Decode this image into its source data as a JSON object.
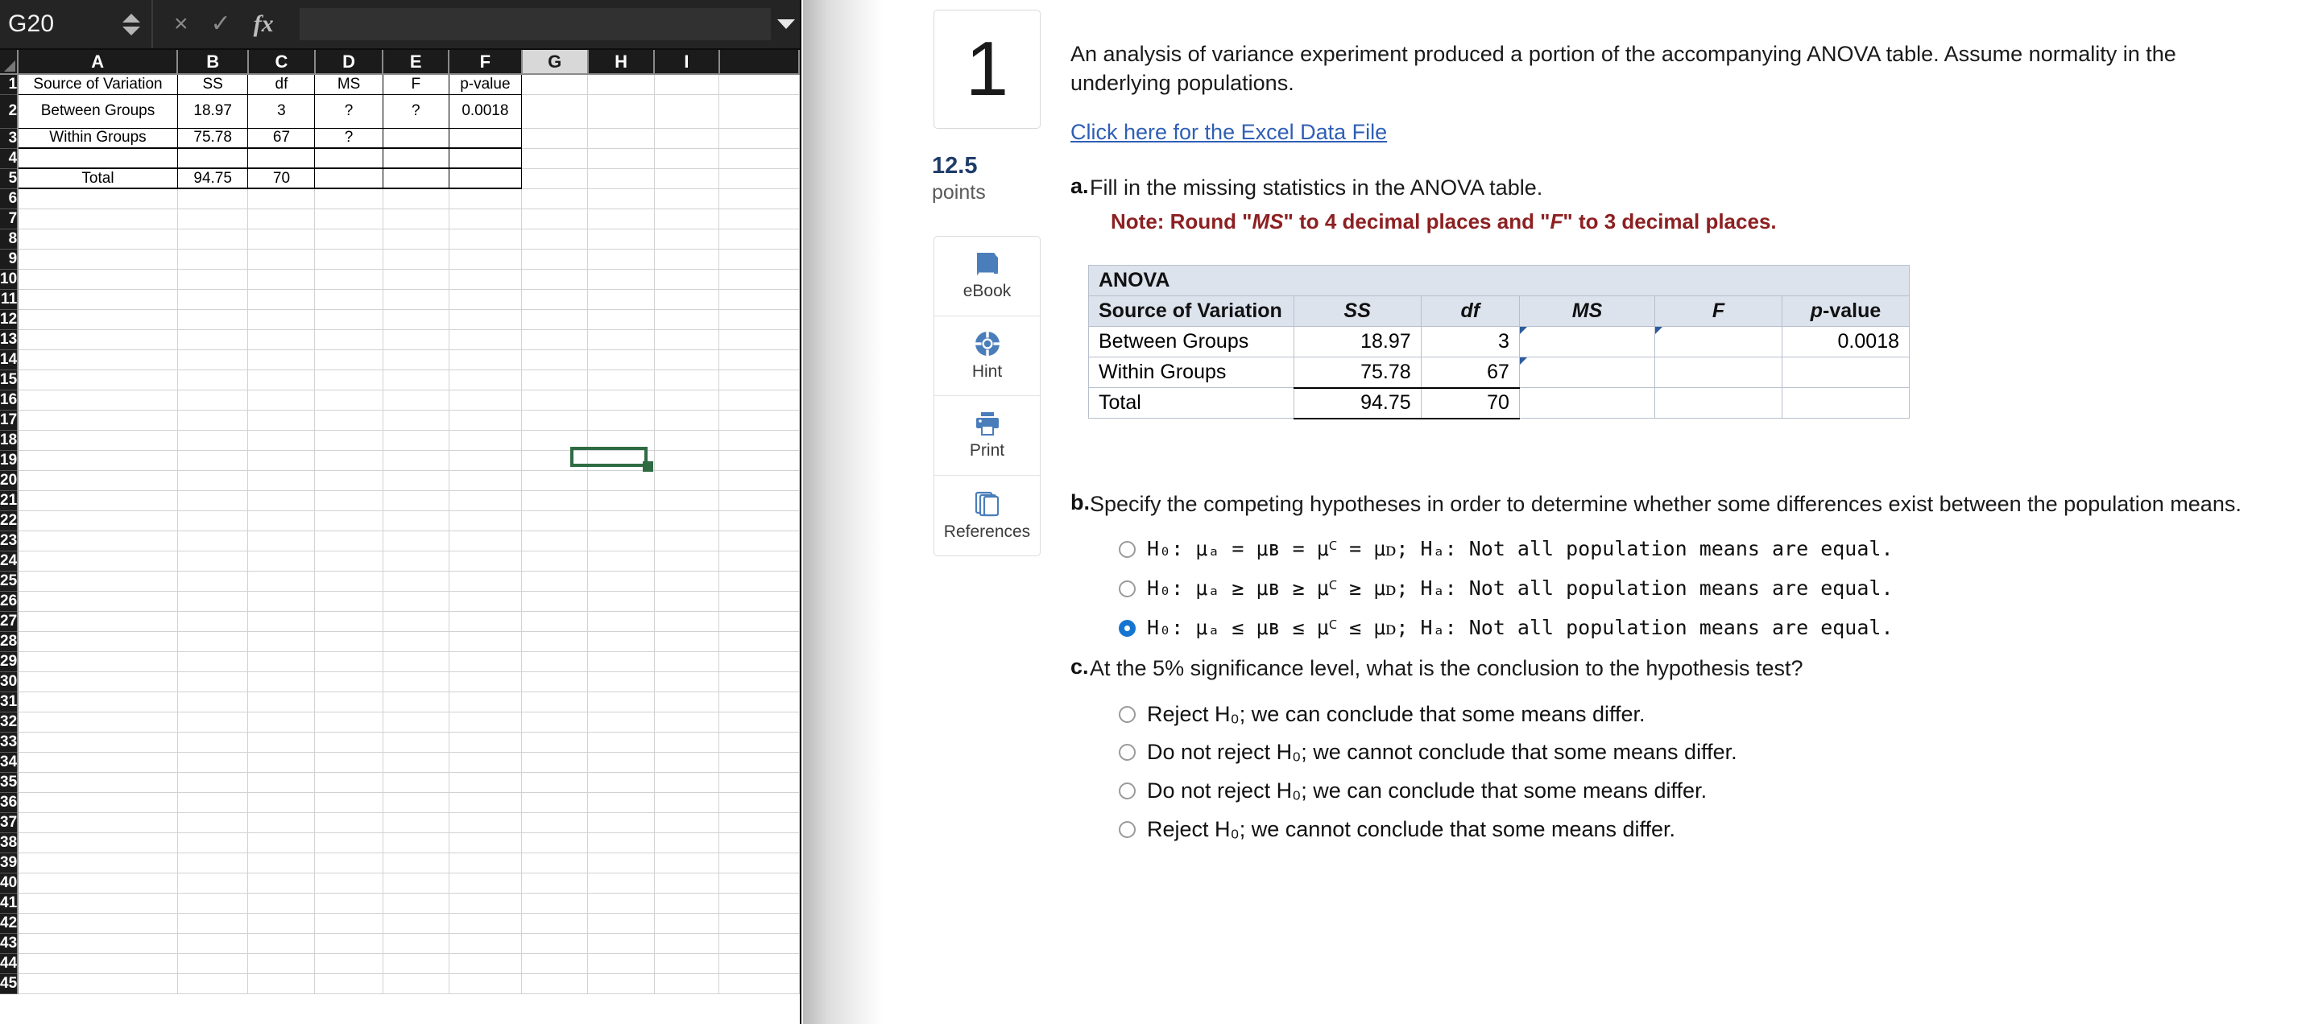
{
  "excel": {
    "namebox_value": "G20",
    "formula_value": "",
    "cancel_icon": "×",
    "confirm_icon": "✓",
    "fx_icon": "fx",
    "columns": [
      "A",
      "B",
      "C",
      "D",
      "E",
      "F",
      "G",
      "H",
      "I"
    ],
    "selected_column": "G",
    "selected_cell": "G20",
    "rows": [
      {
        "num": "1",
        "cells": [
          "Source of Variation",
          "SS",
          "df",
          "MS",
          "F",
          "p-value"
        ]
      },
      {
        "num": "2",
        "cells": [
          "Between Groups",
          "18.97",
          "3",
          "?",
          "?",
          "0.0018"
        ]
      },
      {
        "num": "3",
        "cells": [
          "Within Groups",
          "75.78",
          "67",
          "?",
          "",
          ""
        ]
      },
      {
        "num": "4",
        "cells": [
          "",
          "",
          "",
          "",
          "",
          ""
        ]
      },
      {
        "num": "5",
        "cells": [
          "Total",
          "94.75",
          "70",
          "",
          "",
          ""
        ]
      }
    ],
    "empty_row_numbers": [
      "6",
      "7",
      "8",
      "9",
      "10",
      "11",
      "12",
      "13",
      "14",
      "15",
      "16",
      "17",
      "18",
      "19",
      "20",
      "21",
      "22",
      "23",
      "24",
      "25",
      "26",
      "27",
      "28",
      "29",
      "30",
      "31",
      "32",
      "33",
      "34",
      "35",
      "36",
      "37",
      "38",
      "39",
      "40",
      "41",
      "42",
      "43",
      "44",
      "45"
    ]
  },
  "question": {
    "number": "1",
    "points_value": "12.5",
    "points_label": "points",
    "tools": [
      {
        "name": "ebook",
        "label": "eBook",
        "icon": "book-icon"
      },
      {
        "name": "hint",
        "label": "Hint",
        "icon": "lifesaver-icon"
      },
      {
        "name": "print",
        "label": "Print",
        "icon": "printer-icon"
      },
      {
        "name": "references",
        "label": "References",
        "icon": "pages-icon"
      }
    ],
    "intro": "An analysis of variance experiment produced a portion of the accompanying ANOVA table. Assume normality in the underlying populations.",
    "data_file_link": "Click here for the Excel Data File",
    "parts": {
      "a": {
        "letter": "a.",
        "text": "Fill in the missing statistics in the ANOVA table.",
        "note_prefix": "Note: Round \"",
        "note_ms": "MS",
        "note_mid": "\" to 4 decimal places and \"",
        "note_f": "F",
        "note_suffix": "\" to 3 decimal places."
      },
      "b": {
        "letter": "b.",
        "text": "Specify the competing hypotheses in order to determine whether some differences exist between the population means."
      },
      "c": {
        "letter": "c.",
        "text": "At the 5% significance level, what is the conclusion to the hypothesis test?"
      }
    },
    "anova": {
      "title": "ANOVA",
      "headers": [
        "Source of Variation",
        "SS",
        "df",
        "MS",
        "F",
        "p-value"
      ],
      "rows": [
        {
          "label": "Between Groups",
          "ss": "18.97",
          "df": "3",
          "ms": "",
          "f": "",
          "p": "0.0018",
          "ms_input": true,
          "f_input": true
        },
        {
          "label": "Within Groups",
          "ss": "75.78",
          "df": "67",
          "ms": "",
          "f": "",
          "p": "",
          "ms_input": true,
          "f_input": false
        },
        {
          "label": "Total",
          "ss": "94.75",
          "df": "70",
          "ms": "",
          "f": "",
          "p": "",
          "ms_input": false,
          "f_input": false
        }
      ]
    },
    "hypothesis_choices": [
      {
        "id": "b1",
        "h0": "H₀: μₐ = μʙ = μꟲ = μᴅ;",
        "ha": "Hₐ: Not all population means are equal.",
        "selected": false
      },
      {
        "id": "b2",
        "h0": "H₀: μₐ ≥ μʙ ≥ μꟲ ≥ μᴅ;",
        "ha": "Hₐ: Not all population means are equal.",
        "selected": false
      },
      {
        "id": "b3",
        "h0": "H₀: μₐ ≤ μʙ ≤ μꟲ ≤ μᴅ;",
        "ha": "Hₐ: Not all population means are equal.",
        "selected": true
      }
    ],
    "conclusion_choices": [
      {
        "id": "c1",
        "text": "Reject H₀; we can conclude that some means differ.",
        "selected": false
      },
      {
        "id": "c2",
        "text": "Do not reject H₀; we cannot conclude that some means differ.",
        "selected": false
      },
      {
        "id": "c3",
        "text": "Do not reject H₀; we can conclude that some means differ.",
        "selected": false
      },
      {
        "id": "c4",
        "text": "Reject H₀; we cannot conclude that some means differ.",
        "selected": false
      }
    ]
  },
  "colors": {
    "link": "#2f5fb4",
    "note_red": "#8c2022",
    "accent_blue": "#4a7ebb",
    "radio_selected": "#1675d1",
    "excel_selection": "#2e6b43",
    "points_blue": "#1f3c69"
  }
}
